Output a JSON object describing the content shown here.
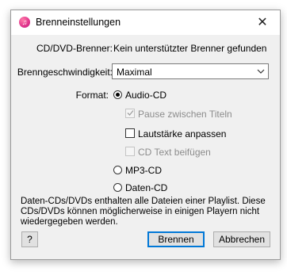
{
  "window": {
    "title": "Brenneinstellungen",
    "close_glyph": "✕",
    "app_icon_glyph": "♫",
    "app_icon": "itunes-icon",
    "close_icon": "close-icon"
  },
  "burner": {
    "label": "CD/DVD-Brenner:",
    "value": "Kein unterstützter Brenner gefunden"
  },
  "speed": {
    "label": "Brenngeschwindigkeit:",
    "selected": "Maximal"
  },
  "format": {
    "label": "Format:",
    "audio_cd": {
      "label": "Audio-CD",
      "selected": true
    },
    "pause_option": {
      "label": "Pause zwischen Titeln",
      "checked": true,
      "enabled": false
    },
    "volume_option": {
      "label": "Lautstärke anpassen",
      "checked": false,
      "enabled": true
    },
    "cdtext_option": {
      "label": "CD Text beifügen",
      "checked": false,
      "enabled": false
    },
    "mp3_cd": {
      "label": "MP3-CD",
      "selected": false
    },
    "data_cd": {
      "label": "Daten-CD",
      "selected": false
    }
  },
  "info_text": "Daten-CDs/DVDs enthalten alle Dateien einer Playlist. Diese CDs/DVDs können möglicherweise in einigen Playern nicht wiedergegeben werden.",
  "buttons": {
    "help": "?",
    "burn": "Brennen",
    "cancel": "Abbrechen"
  },
  "colors": {
    "accent": "#0078d7",
    "dialog_bg": "#f0f0f0",
    "disabled_text": "#8c8c8c"
  }
}
